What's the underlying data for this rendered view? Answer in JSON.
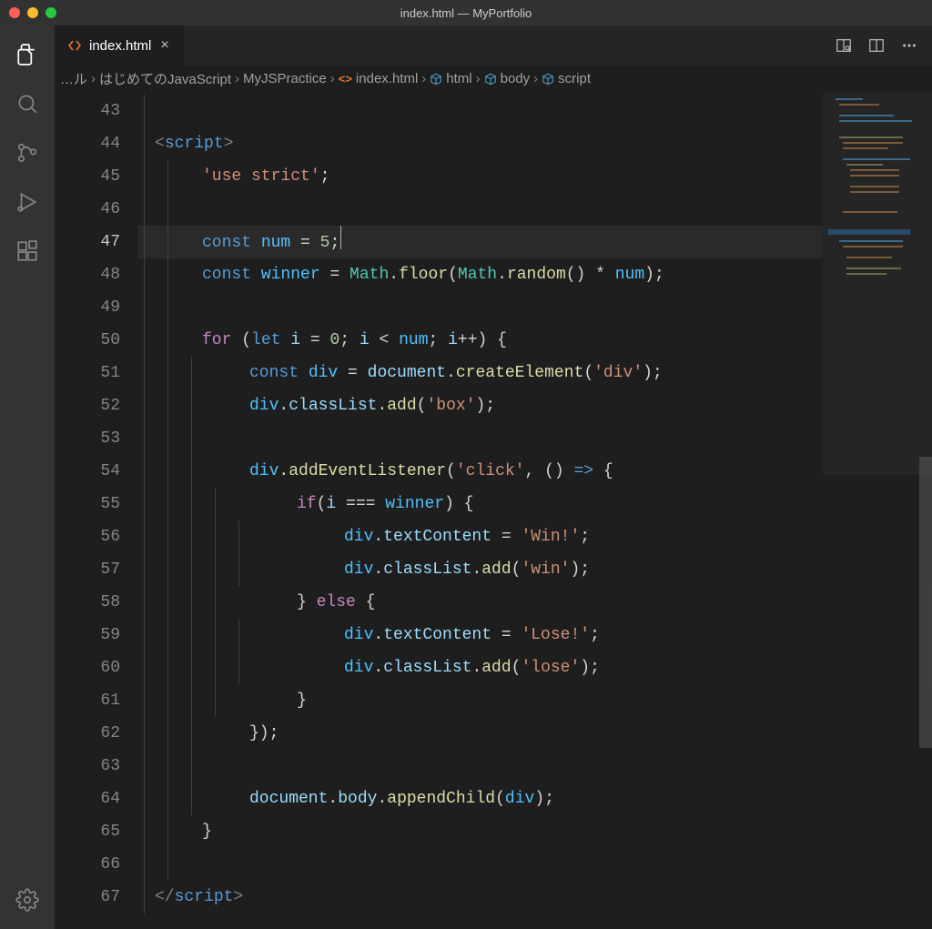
{
  "window": {
    "title": "index.html — MyPortfolio"
  },
  "tab": {
    "filename": "index.html"
  },
  "breadcrumbs": {
    "items": [
      {
        "label": "…ル",
        "icon": "none"
      },
      {
        "label": "はじめてのJavaScript",
        "icon": "folder"
      },
      {
        "label": "MyJSPractice",
        "icon": "folder"
      },
      {
        "label": "index.html",
        "icon": "htmlcode"
      },
      {
        "label": "html",
        "icon": "cube"
      },
      {
        "label": "body",
        "icon": "cube"
      },
      {
        "label": "script",
        "icon": "cube"
      }
    ]
  },
  "editor": {
    "first_line_number": 43,
    "highlighted_line": 47,
    "lines": [
      {
        "n": 43,
        "indent": 4,
        "tokens": []
      },
      {
        "n": 44,
        "indent": 4,
        "tokens": [
          {
            "t": "punc",
            "s": "<"
          },
          {
            "t": "tag",
            "s": "script"
          },
          {
            "t": "punc",
            "s": ">"
          }
        ]
      },
      {
        "n": 45,
        "indent": 5,
        "tokens": [
          {
            "t": "str",
            "s": "'use strict'"
          },
          {
            "t": "paren",
            "s": ";"
          }
        ]
      },
      {
        "n": 46,
        "indent": 5,
        "tokens": []
      },
      {
        "n": 47,
        "indent": 5,
        "tokens": [
          {
            "t": "decl",
            "s": "const"
          },
          {
            "t": "op",
            "s": " "
          },
          {
            "t": "const",
            "s": "num"
          },
          {
            "t": "op",
            "s": " = "
          },
          {
            "t": "num",
            "s": "5"
          },
          {
            "t": "paren",
            "s": ";"
          },
          {
            "t": "cursor",
            "s": ""
          }
        ]
      },
      {
        "n": 48,
        "indent": 5,
        "tokens": [
          {
            "t": "decl",
            "s": "const"
          },
          {
            "t": "op",
            "s": " "
          },
          {
            "t": "const",
            "s": "winner"
          },
          {
            "t": "op",
            "s": " = "
          },
          {
            "t": "obj",
            "s": "Math"
          },
          {
            "t": "paren",
            "s": "."
          },
          {
            "t": "fn",
            "s": "floor"
          },
          {
            "t": "paren",
            "s": "("
          },
          {
            "t": "obj",
            "s": "Math"
          },
          {
            "t": "paren",
            "s": "."
          },
          {
            "t": "fn",
            "s": "random"
          },
          {
            "t": "paren",
            "s": "() * "
          },
          {
            "t": "const",
            "s": "num"
          },
          {
            "t": "paren",
            "s": ");"
          }
        ]
      },
      {
        "n": 49,
        "indent": 5,
        "tokens": []
      },
      {
        "n": 50,
        "indent": 5,
        "tokens": [
          {
            "t": "ctrl",
            "s": "for"
          },
          {
            "t": "paren",
            "s": " ("
          },
          {
            "t": "decl",
            "s": "let"
          },
          {
            "t": "op",
            "s": " "
          },
          {
            "t": "var",
            "s": "i"
          },
          {
            "t": "op",
            "s": " = "
          },
          {
            "t": "num",
            "s": "0"
          },
          {
            "t": "paren",
            "s": "; "
          },
          {
            "t": "var",
            "s": "i"
          },
          {
            "t": "op",
            "s": " < "
          },
          {
            "t": "const",
            "s": "num"
          },
          {
            "t": "paren",
            "s": "; "
          },
          {
            "t": "var",
            "s": "i"
          },
          {
            "t": "op",
            "s": "++"
          },
          {
            "t": "paren",
            "s": ") {"
          }
        ]
      },
      {
        "n": 51,
        "indent": 6,
        "tokens": [
          {
            "t": "decl",
            "s": "const"
          },
          {
            "t": "op",
            "s": " "
          },
          {
            "t": "const",
            "s": "div"
          },
          {
            "t": "op",
            "s": " = "
          },
          {
            "t": "var",
            "s": "document"
          },
          {
            "t": "paren",
            "s": "."
          },
          {
            "t": "fn",
            "s": "createElement"
          },
          {
            "t": "paren",
            "s": "("
          },
          {
            "t": "str",
            "s": "'div'"
          },
          {
            "t": "paren",
            "s": ");"
          }
        ]
      },
      {
        "n": 52,
        "indent": 6,
        "tokens": [
          {
            "t": "const",
            "s": "div"
          },
          {
            "t": "paren",
            "s": "."
          },
          {
            "t": "var",
            "s": "classList"
          },
          {
            "t": "paren",
            "s": "."
          },
          {
            "t": "fn",
            "s": "add"
          },
          {
            "t": "paren",
            "s": "("
          },
          {
            "t": "str",
            "s": "'box'"
          },
          {
            "t": "paren",
            "s": ");"
          }
        ]
      },
      {
        "n": 53,
        "indent": 6,
        "tokens": []
      },
      {
        "n": 54,
        "indent": 6,
        "tokens": [
          {
            "t": "const",
            "s": "div"
          },
          {
            "t": "paren",
            "s": "."
          },
          {
            "t": "fn",
            "s": "addEventListener"
          },
          {
            "t": "paren",
            "s": "("
          },
          {
            "t": "str",
            "s": "'click'"
          },
          {
            "t": "paren",
            "s": ", () "
          },
          {
            "t": "arrow",
            "s": "=>"
          },
          {
            "t": "paren",
            "s": " {"
          }
        ]
      },
      {
        "n": 55,
        "indent": 7,
        "tokens": [
          {
            "t": "ctrl",
            "s": "if"
          },
          {
            "t": "paren",
            "s": "("
          },
          {
            "t": "var",
            "s": "i"
          },
          {
            "t": "op",
            "s": " === "
          },
          {
            "t": "const",
            "s": "winner"
          },
          {
            "t": "paren",
            "s": ") {"
          }
        ]
      },
      {
        "n": 56,
        "indent": 8,
        "tokens": [
          {
            "t": "const",
            "s": "div"
          },
          {
            "t": "paren",
            "s": "."
          },
          {
            "t": "var",
            "s": "textContent"
          },
          {
            "t": "op",
            "s": " = "
          },
          {
            "t": "str",
            "s": "'Win!'"
          },
          {
            "t": "paren",
            "s": ";"
          }
        ]
      },
      {
        "n": 57,
        "indent": 8,
        "tokens": [
          {
            "t": "const",
            "s": "div"
          },
          {
            "t": "paren",
            "s": "."
          },
          {
            "t": "var",
            "s": "classList"
          },
          {
            "t": "paren",
            "s": "."
          },
          {
            "t": "fn",
            "s": "add"
          },
          {
            "t": "paren",
            "s": "("
          },
          {
            "t": "str",
            "s": "'win'"
          },
          {
            "t": "paren",
            "s": ");"
          }
        ]
      },
      {
        "n": 58,
        "indent": 7,
        "tokens": [
          {
            "t": "paren",
            "s": "} "
          },
          {
            "t": "ctrl",
            "s": "else"
          },
          {
            "t": "paren",
            "s": " {"
          }
        ]
      },
      {
        "n": 59,
        "indent": 8,
        "tokens": [
          {
            "t": "const",
            "s": "div"
          },
          {
            "t": "paren",
            "s": "."
          },
          {
            "t": "var",
            "s": "textContent"
          },
          {
            "t": "op",
            "s": " = "
          },
          {
            "t": "str",
            "s": "'Lose!'"
          },
          {
            "t": "paren",
            "s": ";"
          }
        ]
      },
      {
        "n": 60,
        "indent": 8,
        "tokens": [
          {
            "t": "const",
            "s": "div"
          },
          {
            "t": "paren",
            "s": "."
          },
          {
            "t": "var",
            "s": "classList"
          },
          {
            "t": "paren",
            "s": "."
          },
          {
            "t": "fn",
            "s": "add"
          },
          {
            "t": "paren",
            "s": "("
          },
          {
            "t": "str",
            "s": "'lose'"
          },
          {
            "t": "paren",
            "s": ");"
          }
        ]
      },
      {
        "n": 61,
        "indent": 7,
        "tokens": [
          {
            "t": "paren",
            "s": "}"
          }
        ]
      },
      {
        "n": 62,
        "indent": 6,
        "tokens": [
          {
            "t": "paren",
            "s": "});"
          }
        ]
      },
      {
        "n": 63,
        "indent": 6,
        "tokens": []
      },
      {
        "n": 64,
        "indent": 6,
        "tokens": [
          {
            "t": "var",
            "s": "document"
          },
          {
            "t": "paren",
            "s": "."
          },
          {
            "t": "var",
            "s": "body"
          },
          {
            "t": "paren",
            "s": "."
          },
          {
            "t": "fn",
            "s": "appendChild"
          },
          {
            "t": "paren",
            "s": "("
          },
          {
            "t": "const",
            "s": "div"
          },
          {
            "t": "paren",
            "s": ");"
          }
        ]
      },
      {
        "n": 65,
        "indent": 5,
        "tokens": [
          {
            "t": "paren",
            "s": "}"
          }
        ]
      },
      {
        "n": 66,
        "indent": 5,
        "tokens": []
      },
      {
        "n": 67,
        "indent": 4,
        "tokens": [
          {
            "t": "punc",
            "s": "</"
          },
          {
            "t": "tag",
            "s": "script"
          },
          {
            "t": "punc",
            "s": ">"
          }
        ]
      }
    ]
  }
}
